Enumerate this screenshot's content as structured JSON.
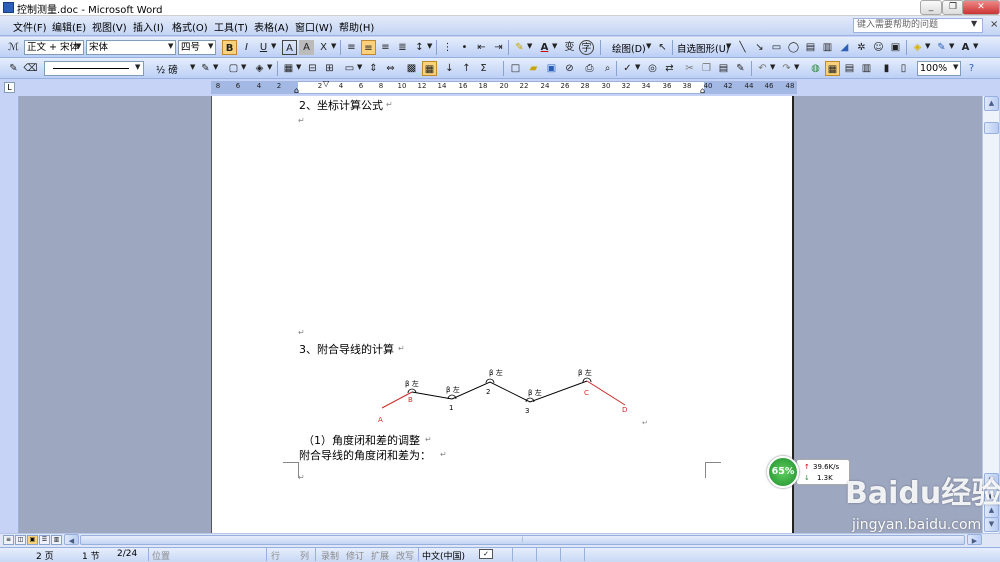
{
  "window": {
    "title": "控制测量.doc - Microsoft Word",
    "minimize": "_",
    "restore": "❐",
    "close": "✕"
  },
  "menu": {
    "items": [
      "文件(F)",
      "编辑(E)",
      "视图(V)",
      "插入(I)",
      "格式(O)",
      "工具(T)",
      "表格(A)",
      "窗口(W)",
      "帮助(H)"
    ],
    "help_placeholder": "键入需要帮助的问题",
    "doc_close": "×"
  },
  "toolbar_formatting": {
    "style_value": "正文 + 宋体",
    "font_value": "宋体",
    "size_value": "四号",
    "bold": "B",
    "italic": "I",
    "underline": "U",
    "char_border": "A",
    "char_shading": "A",
    "char_scale": "X",
    "font_color": "A",
    "phonetic": "变",
    "enclose": "字",
    "drawing_label": "绘图(D)",
    "autoshapes_label": "自选图形(U)"
  },
  "toolbar_tables": {
    "line_width": "½ 磅",
    "zoom_value": "100%"
  },
  "ruler": {
    "left_numbers": [
      "8",
      "6",
      "4",
      "2"
    ],
    "numbers": [
      "2",
      "4",
      "6",
      "8",
      "10",
      "12",
      "14",
      "16",
      "18",
      "20",
      "22",
      "24",
      "26",
      "28",
      "30",
      "32",
      "34",
      "36",
      "38",
      "40",
      "42",
      "44",
      "46",
      "48"
    ],
    "corner": "L"
  },
  "document": {
    "heading_2": "2、坐标计算公式",
    "heading_3": "3、附合导线的计算",
    "sub_1": "（1）角度闭和差的调整",
    "line_1": "附合导线的角度闭和差为：",
    "para_mark": "↵",
    "diagram": {
      "angle_label": "β 左",
      "point_labels": [
        "A",
        "B",
        "1",
        "2",
        "3",
        "C",
        "D"
      ]
    }
  },
  "statusbar": {
    "page": "2 页",
    "section": "1 节",
    "page_of": "2/24",
    "at": "位置",
    "ln": "行",
    "col": "列",
    "rec": "录制",
    "trk": "修订",
    "ext": "扩展",
    "ovr": "改写",
    "language": "中文(中国)"
  },
  "overlay": {
    "net_percent": "65%",
    "upload_speed": "39.6K/s",
    "download_speed": "1.3K",
    "watermark_logo": "Baidu经验",
    "watermark_url": "jingyan.baidu.com"
  },
  "colors": {
    "accent_blue": "#2b5fb8",
    "diagram_red": "#cc2b2b",
    "bold_highlight": "#fbd27c"
  }
}
